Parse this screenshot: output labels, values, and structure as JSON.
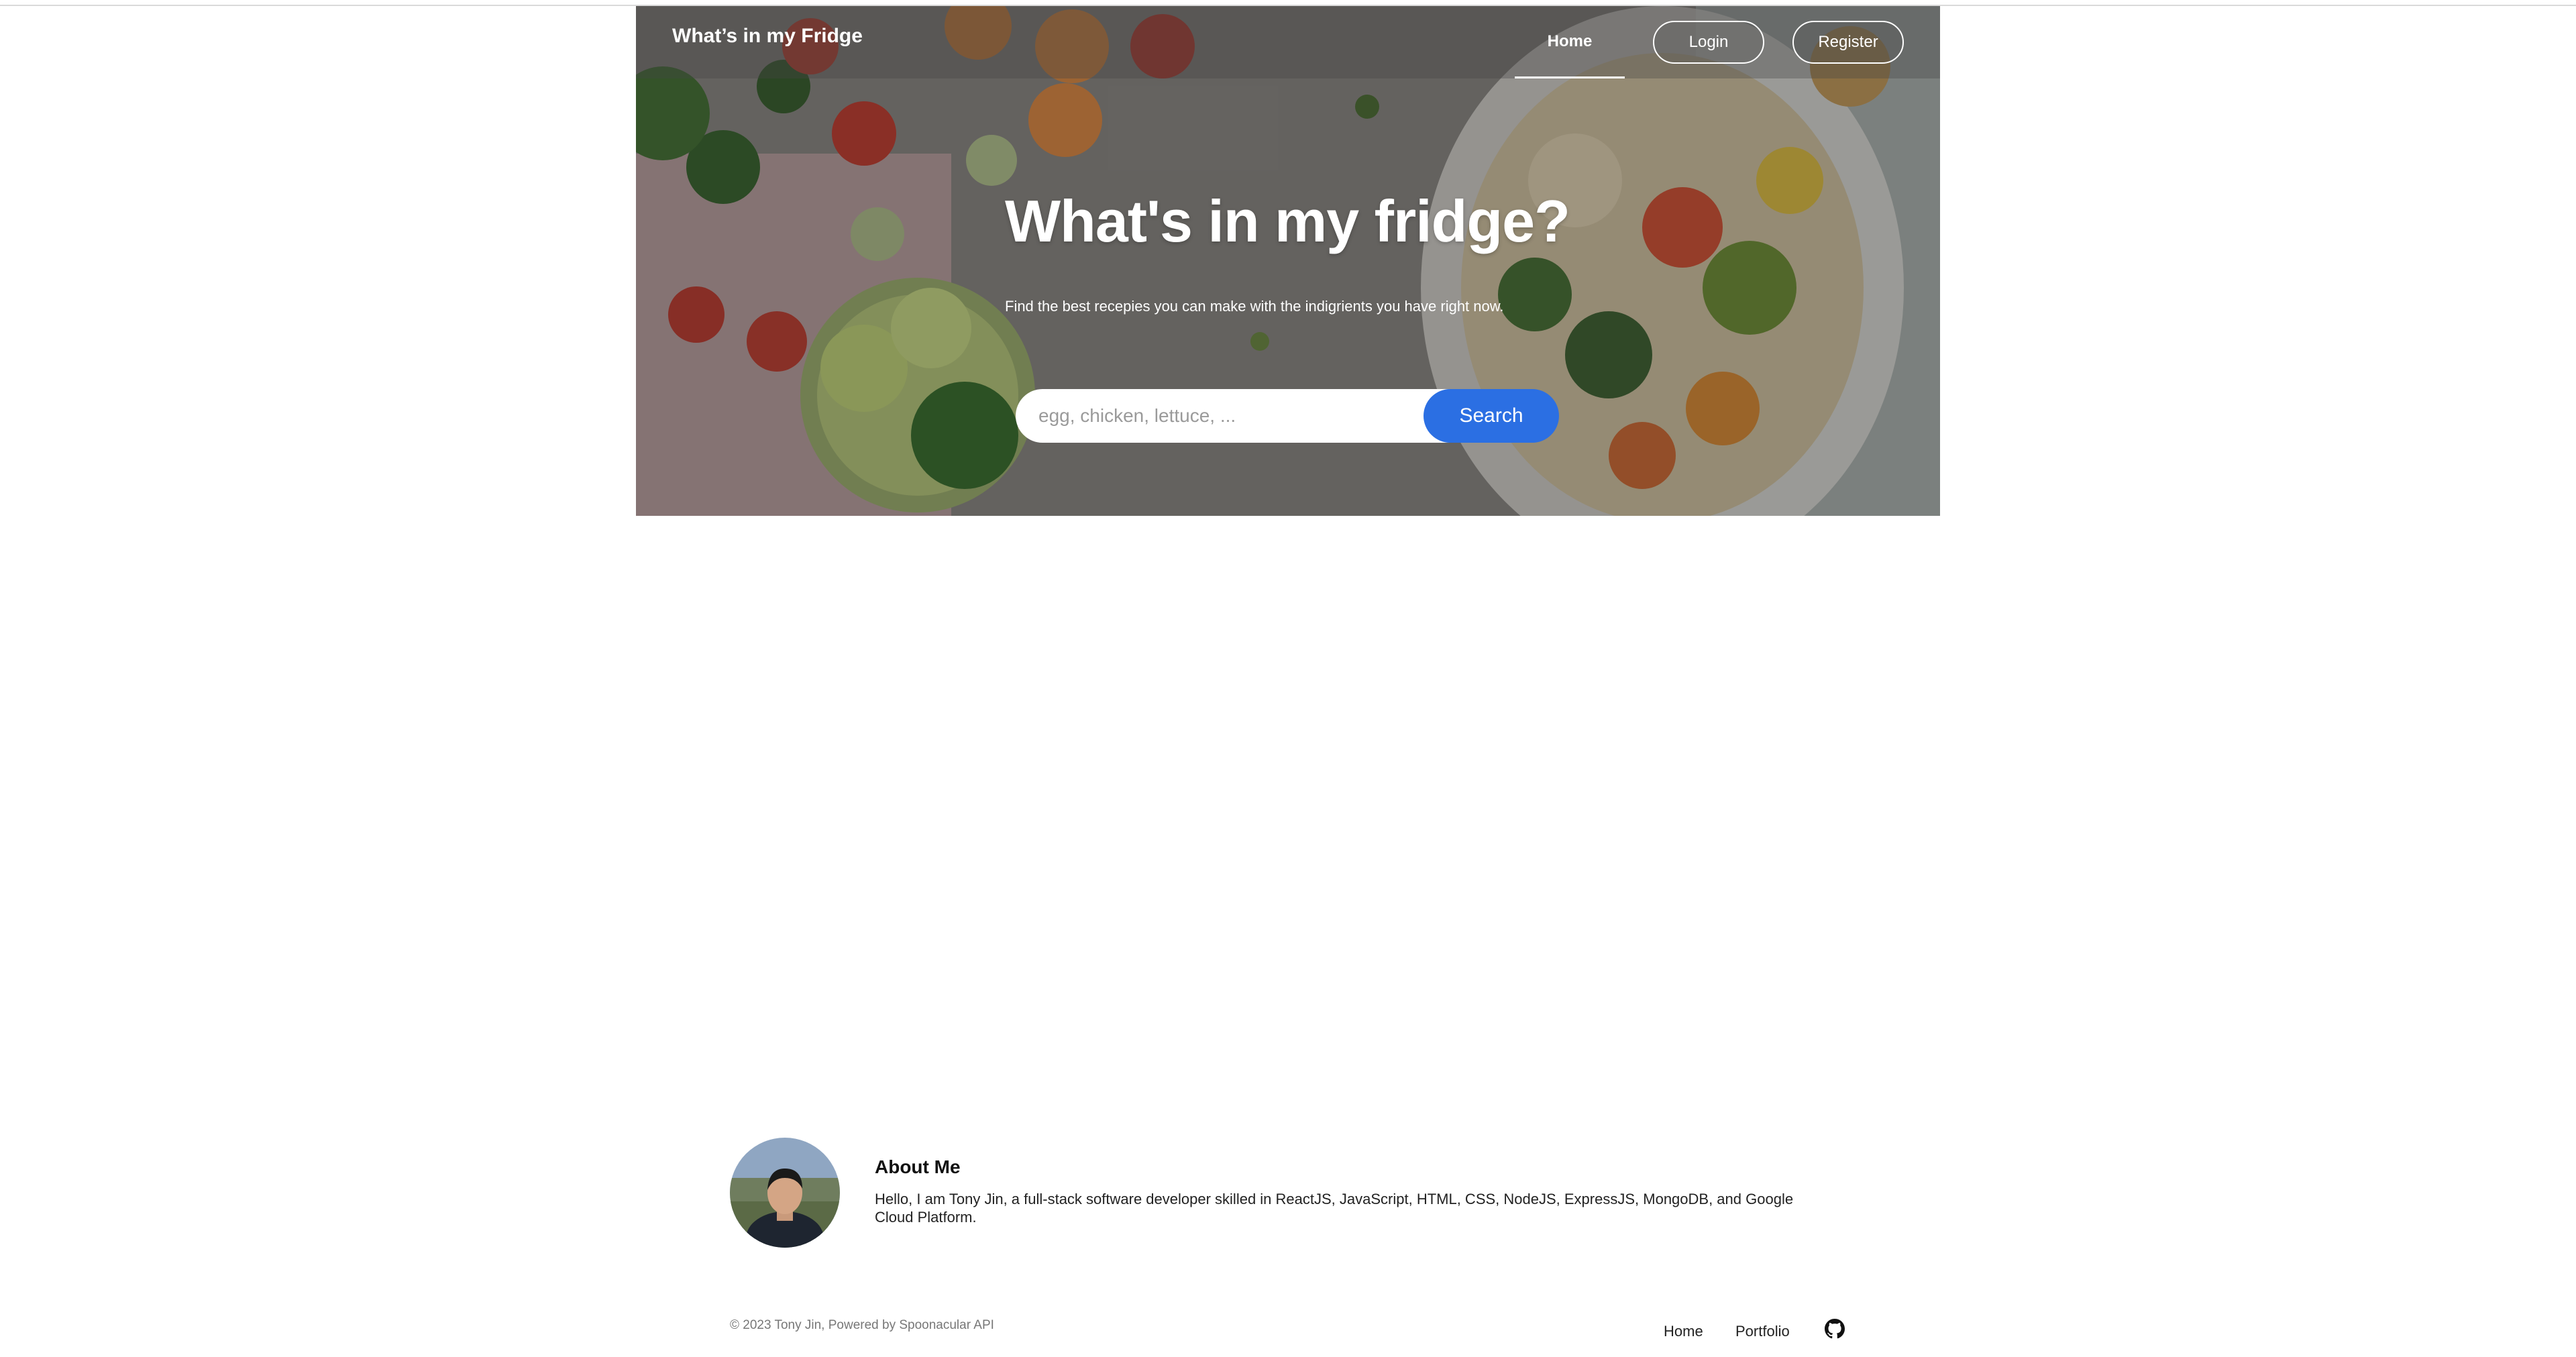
{
  "nav": {
    "brand": "What’s in my Fridge",
    "home": "Home",
    "login": "Login",
    "register": "Register"
  },
  "hero": {
    "title": "What's in my fridge?",
    "subtitle": "Find the best recepies you can make with the indigrients you have right now.",
    "search_placeholder": "egg, chicken, lettuce, ...",
    "search_button": "Search"
  },
  "about": {
    "title": "About Me",
    "text": "Hello, I am Tony Jin, a full-stack software developer skilled in ReactJS, JavaScript, HTML, CSS, NodeJS, ExpressJS, MongoDB, and Google Cloud Platform."
  },
  "footer": {
    "copyright": "© 2023 Tony Jin, Powered by Spoonacular API",
    "links": [
      "Home",
      "Portfolio"
    ],
    "github_icon": "github-icon"
  },
  "colors": {
    "accent": "#2b6fe3",
    "nav_text": "#ffffff"
  }
}
